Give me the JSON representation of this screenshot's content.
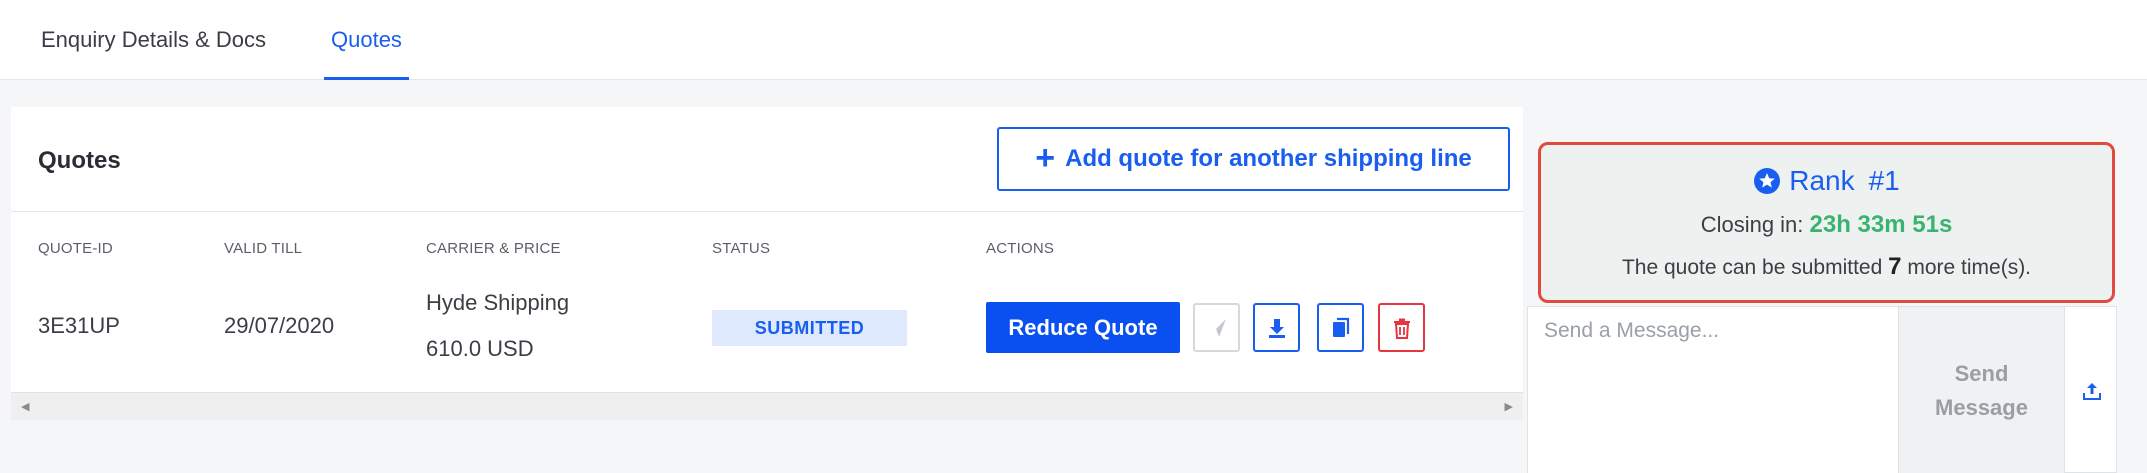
{
  "tabs": [
    {
      "label": "Enquiry Details & Docs",
      "active": false
    },
    {
      "label": "Quotes",
      "active": true
    }
  ],
  "quotes_card": {
    "title": "Quotes",
    "add_button_label": "Add quote for another shipping line",
    "columns": [
      "QUOTE-ID",
      "VALID TILL",
      "CARRIER & PRICE",
      "STATUS",
      "ACTIONS"
    ],
    "rows": [
      {
        "quote_id": "3E31UP",
        "valid_till": "29/07/2020",
        "carrier": "Hyde Shipping",
        "price": "610.0 USD",
        "status": "SUBMITTED",
        "reduce_label": "Reduce Quote"
      }
    ],
    "action_icons": [
      "send-icon",
      "download-icon",
      "copy-icon",
      "trash-icon"
    ]
  },
  "rank_panel": {
    "rank_label": "Rank",
    "rank_value": "#1",
    "closing_label": "Closing in:",
    "closing_time": "23h 33m 51s",
    "note_prefix": "The quote can be submitted",
    "remaining_count": "7",
    "note_suffix": "more time(s)."
  },
  "message": {
    "placeholder": "Send a Message...",
    "send_label_line1": "Send",
    "send_label_line2": "Message"
  },
  "colors": {
    "primary": "#1a5ef0",
    "success": "#3ab36e",
    "danger": "#e5353f",
    "rank_border": "#e04b3d"
  }
}
